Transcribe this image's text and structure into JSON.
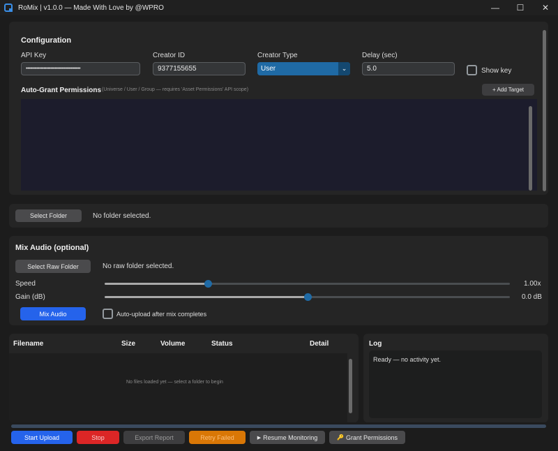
{
  "window": {
    "title": "RoMix | v1.0.0 — Made With Love by @WPRO",
    "minimize": "—",
    "maximize": "☐",
    "close": "✕"
  },
  "config": {
    "heading": "Configuration",
    "api_key": {
      "label": "API Key",
      "value": "••••••••••••••••••••••••••••••••••••••••"
    },
    "creator_id": {
      "label": "Creator ID",
      "value": "9377155655"
    },
    "creator_type": {
      "label": "Creator Type",
      "value": "User",
      "arrow": "⌄"
    },
    "delay": {
      "label": "Delay (sec)",
      "value": "5.0"
    },
    "show_key": "Show key",
    "auto_grant": {
      "heading": "Auto-Grant Permissions",
      "hint": "(Universe / User / Group — requires 'Asset Permissions' API scope)",
      "add_target": "+ Add Target"
    }
  },
  "folder": {
    "button": "Select Folder",
    "status": "No folder selected."
  },
  "mix": {
    "heading": "Mix Audio (optional)",
    "raw_button": "Select Raw Folder",
    "raw_status": "No raw folder selected.",
    "speed": {
      "label": "Speed",
      "value_text": "1.00x",
      "fraction": 0.255
    },
    "gain": {
      "label": "Gain (dB)",
      "value_text": "0.0 dB",
      "fraction": 0.5
    },
    "mix_button": "Mix Audio",
    "auto_upload": "Auto-upload after mix completes"
  },
  "files": {
    "columns": [
      "Filename",
      "Size",
      "Volume",
      "Status",
      "Detail"
    ],
    "empty": "No files loaded yet — select a folder to begin"
  },
  "log": {
    "heading": "Log",
    "text": "Ready — no activity yet."
  },
  "actions": {
    "start": "Start Upload",
    "stop": "Stop",
    "export": "Export Report",
    "retry": "Retry Failed",
    "resume": "Resume Monitoring",
    "resume_icon": "▶",
    "grant": "Grant Permissions",
    "grant_icon": "🔑"
  },
  "colors": {
    "accent": "#1f6aa5",
    "primary_button": "#2563eb",
    "stop": "#dc2626",
    "retry": "#d97706"
  }
}
